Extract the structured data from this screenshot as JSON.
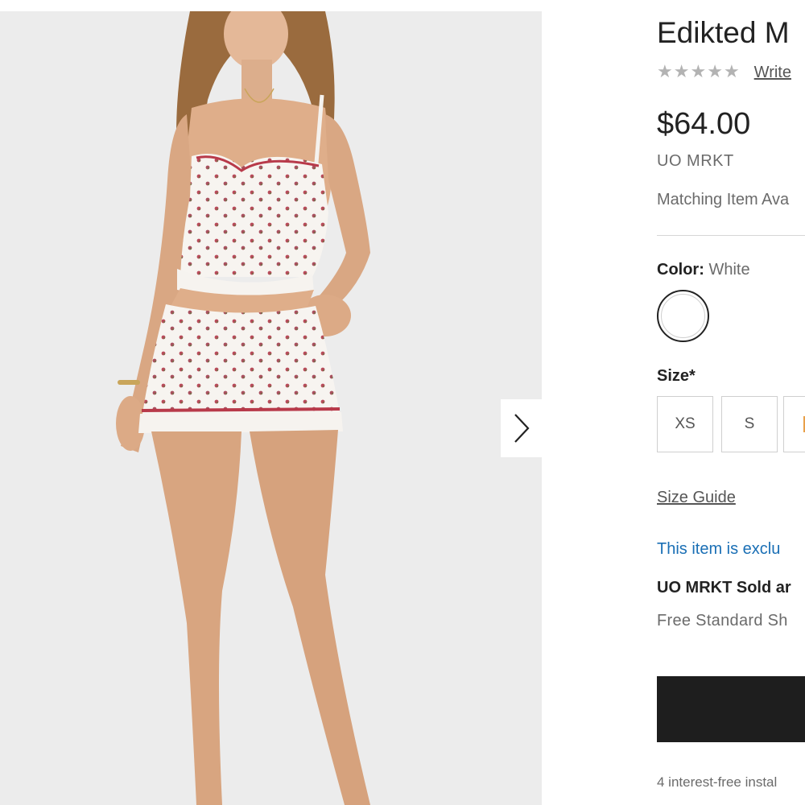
{
  "product": {
    "title": "Edikted M",
    "price": "$64.00",
    "brand": "UO MRKT",
    "matching_note": "Matching Item Ava",
    "write_review": "Write"
  },
  "rating": {
    "stars_filled": 0,
    "stars_total": 5,
    "star_glyph": "★"
  },
  "color": {
    "label": "Color:",
    "value": "White",
    "swatch_hex": "#ffffff"
  },
  "size": {
    "label": "Size*",
    "options": [
      "XS",
      "S"
    ],
    "guide_link": "Size Guide"
  },
  "notices": {
    "exclusive": "This item is exclu",
    "sold_by": "UO MRKT Sold ar",
    "shipping": "Free Standard Sh",
    "installments": "4 interest-free instal"
  },
  "gallery": {
    "next_icon": "chevron-right-icon"
  },
  "colors": {
    "accent_link": "#1a6fb5",
    "button_dark": "#1e1e1e",
    "gallery_bg": "#ececec"
  }
}
